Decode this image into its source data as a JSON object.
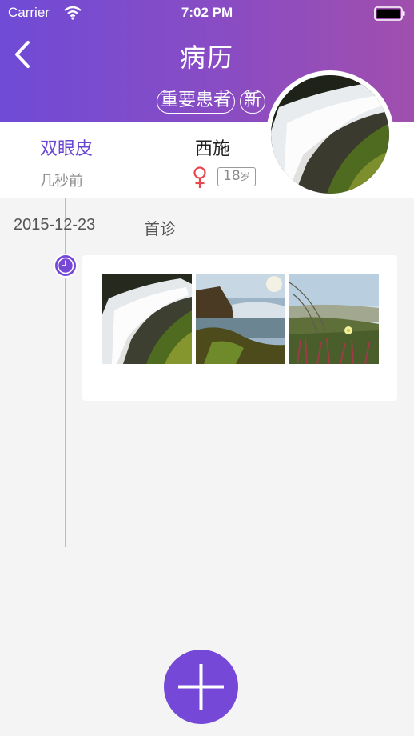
{
  "status_bar": {
    "carrier": "Carrier",
    "time": "7:02 PM"
  },
  "nav": {
    "title": "病历",
    "back_icon": "chevron-left-icon"
  },
  "tags": [
    "重要患者",
    "新"
  ],
  "patient": {
    "surgery": "双眼皮",
    "updated": "几秒前",
    "name": "西施",
    "gender_icon": "female-icon",
    "age": "18",
    "age_unit": "岁"
  },
  "records": [
    {
      "date": "2015-12-23",
      "type": "首诊",
      "photo_count": 3
    }
  ],
  "colors": {
    "accent": "#7548d8",
    "header_start": "#6f4bd6",
    "header_end": "#a04fad",
    "female": "#e8464b"
  },
  "fab": {
    "icon": "plus-icon"
  }
}
